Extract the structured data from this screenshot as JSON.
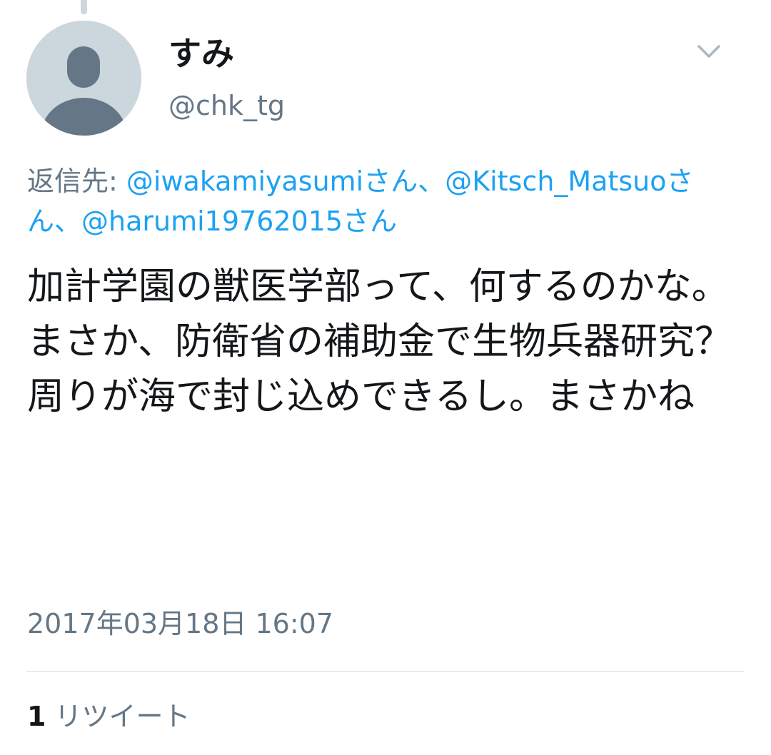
{
  "tweet": {
    "display_name": "すみ",
    "handle": "@chk_tg",
    "reply_prefix": "返信先: ",
    "reply_mentions": [
      "@iwakamiyasumiさん",
      "@Kitsch_Matsuoさん",
      "@harumi19762015さん"
    ],
    "reply_separator": "、",
    "text": "加計学園の獣医学部って、何するのかな。\nまさか、防衛省の補助金で生物兵器研究？\n周りが海で封じ込めできるし。まさかね",
    "timestamp": "2017年03月18日 16:07",
    "retweet_count": "1",
    "retweet_label": "リツイート"
  },
  "icons": {
    "avatar": "default-avatar-icon",
    "menu": "chevron-down-icon"
  },
  "colors": {
    "link": "#1da1f2",
    "secondary_text": "#657786",
    "primary_text": "#14171a",
    "avatar_bg": "#ccd6dd",
    "avatar_fg": "#657786",
    "divider": "#e6ecf0"
  }
}
